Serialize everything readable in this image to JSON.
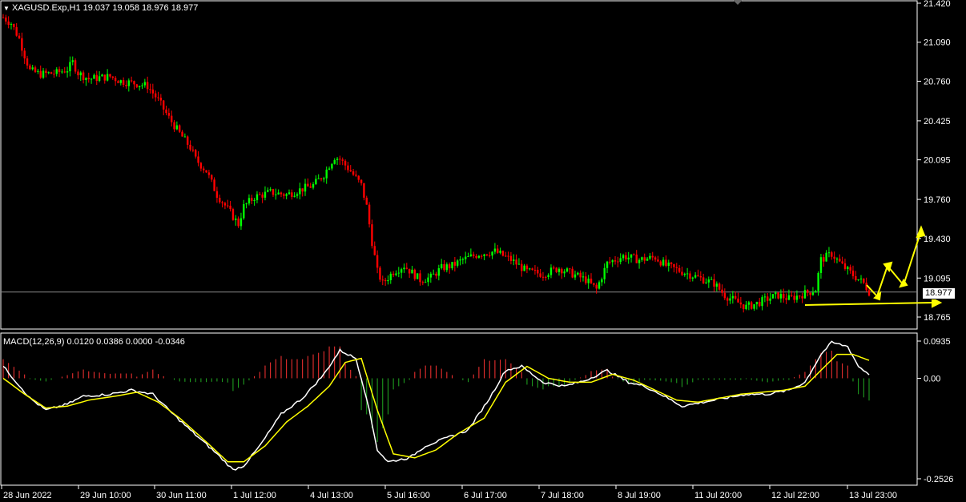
{
  "header": {
    "symbol_line": "XAGUSD.Exp,H1  19.037 19.058 18.976 18.977",
    "macd_line": "MACD(12,26,9) 0.0120 0.0386 0.0000 -0.0346"
  },
  "current_price": "18.977",
  "colors": {
    "background": "#000000",
    "bull": "#00ff00",
    "bear": "#ff0000",
    "macd_line": "#ffffff",
    "signal_line": "#ffff00",
    "hist_pos": "#ff3333",
    "hist_neg": "#22aa22",
    "annotation": "#ffff00"
  },
  "chart_data": [
    {
      "type": "candlestick",
      "symbol": "XAGUSD.Exp",
      "timeframe": "H1",
      "y_ticks": [
        "21.420",
        "21.090",
        "20.760",
        "20.425",
        "20.095",
        "19.760",
        "19.430",
        "19.095",
        "18.765"
      ],
      "ylim": [
        18.6,
        21.42
      ],
      "x_ticks": [
        "28 Jun 2022",
        "29 Jun 10:00",
        "30 Jun 11:00",
        "1 Jul 12:00",
        "4 Jul 13:00",
        "5 Jul 16:00",
        "6 Jul 17:00",
        "7 Jul 18:00",
        "8 Jul 19:00",
        "11 Jul 20:00",
        "12 Jul 22:00",
        "13 Jul 23:00"
      ],
      "close_path": [
        [
          0,
          21.3
        ],
        [
          3,
          21.25
        ],
        [
          6,
          21.12
        ],
        [
          8,
          20.98
        ],
        [
          10,
          20.85
        ],
        [
          14,
          20.82
        ],
        [
          20,
          20.83
        ],
        [
          24,
          20.86
        ],
        [
          26,
          20.92
        ],
        [
          28,
          20.83
        ],
        [
          32,
          20.78
        ],
        [
          40,
          20.8
        ],
        [
          44,
          20.76
        ],
        [
          50,
          20.74
        ],
        [
          54,
          20.72
        ],
        [
          58,
          20.6
        ],
        [
          62,
          20.45
        ],
        [
          66,
          20.32
        ],
        [
          70,
          20.2
        ],
        [
          72,
          20.1
        ],
        [
          76,
          20.0
        ],
        [
          80,
          19.8
        ],
        [
          84,
          19.68
        ],
        [
          88,
          19.55
        ],
        [
          90,
          19.7
        ],
        [
          94,
          19.78
        ],
        [
          100,
          19.82
        ],
        [
          106,
          19.8
        ],
        [
          112,
          19.85
        ],
        [
          116,
          19.88
        ],
        [
          120,
          19.97
        ],
        [
          122,
          20.05
        ],
        [
          124,
          20.12
        ],
        [
          126,
          20.1
        ],
        [
          130,
          20.0
        ],
        [
          134,
          19.88
        ],
        [
          136,
          19.7
        ],
        [
          138,
          19.4
        ],
        [
          140,
          19.15
        ],
        [
          142,
          19.05
        ],
        [
          146,
          19.15
        ],
        [
          150,
          19.2
        ],
        [
          156,
          19.08
        ],
        [
          160,
          19.1
        ],
        [
          164,
          19.18
        ],
        [
          168,
          19.2
        ],
        [
          172,
          19.25
        ],
        [
          178,
          19.3
        ],
        [
          184,
          19.32
        ],
        [
          190,
          19.25
        ],
        [
          196,
          19.15
        ],
        [
          202,
          19.13
        ],
        [
          208,
          19.18
        ],
        [
          214,
          19.12
        ],
        [
          218,
          19.08
        ],
        [
          222,
          19.0
        ],
        [
          226,
          19.22
        ],
        [
          232,
          19.28
        ],
        [
          238,
          19.25
        ],
        [
          244,
          19.27
        ],
        [
          248,
          19.2
        ],
        [
          254,
          19.15
        ],
        [
          260,
          19.1
        ],
        [
          266,
          19.05
        ],
        [
          270,
          18.95
        ],
        [
          274,
          18.9
        ],
        [
          278,
          18.85
        ],
        [
          282,
          18.88
        ],
        [
          286,
          18.92
        ],
        [
          290,
          18.95
        ],
        [
          294,
          18.92
        ],
        [
          298,
          18.95
        ],
        [
          302,
          18.98
        ],
        [
          304,
          19.0
        ],
        [
          306,
          19.25
        ],
        [
          310,
          19.3
        ],
        [
          314,
          19.2
        ],
        [
          318,
          19.12
        ],
        [
          322,
          19.05
        ],
        [
          324,
          18.98
        ]
      ],
      "current_price": 18.977,
      "annotations": [
        "yellow zigzag projection arrow",
        "yellow horizontal arrow at 18.86"
      ]
    },
    {
      "type": "line",
      "name": "MACD(12,26,9)",
      "y_ticks": [
        "0.0935",
        "0.00",
        "-0.2526"
      ],
      "ylim": [
        -0.2526,
        0.0935
      ],
      "series": [
        {
          "name": "MACD",
          "points": [
            [
              0,
              0.03
            ],
            [
              10,
              -0.05
            ],
            [
              16,
              -0.08
            ],
            [
              24,
              -0.065
            ],
            [
              30,
              -0.045
            ],
            [
              40,
              -0.04
            ],
            [
              48,
              -0.03
            ],
            [
              56,
              -0.04
            ],
            [
              62,
              -0.08
            ],
            [
              70,
              -0.13
            ],
            [
              80,
              -0.19
            ],
            [
              86,
              -0.23
            ],
            [
              90,
              -0.22
            ],
            [
              96,
              -0.17
            ],
            [
              104,
              -0.09
            ],
            [
              112,
              -0.05
            ],
            [
              120,
              0.01
            ],
            [
              126,
              0.07
            ],
            [
              132,
              0.05
            ],
            [
              136,
              -0.05
            ],
            [
              140,
              -0.18
            ],
            [
              144,
              -0.21
            ],
            [
              152,
              -0.2
            ],
            [
              158,
              -0.17
            ],
            [
              166,
              -0.15
            ],
            [
              174,
              -0.13
            ],
            [
              182,
              -0.05
            ],
            [
              188,
              0.02
            ],
            [
              194,
              0.03
            ],
            [
              202,
              -0.01
            ],
            [
              210,
              -0.02
            ],
            [
              218,
              -0.005
            ],
            [
              226,
              0.02
            ],
            [
              234,
              -0.01
            ],
            [
              240,
              -0.02
            ],
            [
              246,
              -0.04
            ],
            [
              254,
              -0.07
            ],
            [
              262,
              -0.06
            ],
            [
              270,
              -0.05
            ],
            [
              278,
              -0.04
            ],
            [
              286,
              -0.04
            ],
            [
              294,
              -0.03
            ],
            [
              300,
              -0.01
            ],
            [
              306,
              0.06
            ],
            [
              310,
              0.09
            ],
            [
              316,
              0.08
            ],
            [
              320,
              0.03
            ],
            [
              324,
              0.01
            ]
          ]
        },
        {
          "name": "Signal",
          "points": [
            [
              0,
              0.0
            ],
            [
              8,
              -0.04
            ],
            [
              16,
              -0.075
            ],
            [
              24,
              -0.07
            ],
            [
              32,
              -0.055
            ],
            [
              42,
              -0.045
            ],
            [
              50,
              -0.035
            ],
            [
              58,
              -0.06
            ],
            [
              66,
              -0.1
            ],
            [
              76,
              -0.16
            ],
            [
              84,
              -0.21
            ],
            [
              90,
              -0.21
            ],
            [
              98,
              -0.17
            ],
            [
              106,
              -0.11
            ],
            [
              114,
              -0.07
            ],
            [
              122,
              -0.02
            ],
            [
              128,
              0.04
            ],
            [
              134,
              0.05
            ],
            [
              140,
              -0.08
            ],
            [
              146,
              -0.19
            ],
            [
              154,
              -0.2
            ],
            [
              162,
              -0.18
            ],
            [
              170,
              -0.14
            ],
            [
              180,
              -0.1
            ],
            [
              188,
              -0.01
            ],
            [
              196,
              0.03
            ],
            [
              204,
              0.0
            ],
            [
              212,
              -0.01
            ],
            [
              220,
              -0.01
            ],
            [
              228,
              0.01
            ],
            [
              236,
              -0.005
            ],
            [
              244,
              -0.03
            ],
            [
              252,
              -0.055
            ],
            [
              260,
              -0.06
            ],
            [
              268,
              -0.05
            ],
            [
              276,
              -0.04
            ],
            [
              284,
              -0.035
            ],
            [
              292,
              -0.03
            ],
            [
              300,
              -0.02
            ],
            [
              306,
              0.02
            ],
            [
              312,
              0.06
            ],
            [
              318,
              0.06
            ],
            [
              324,
              0.045
            ]
          ]
        },
        {
          "name": "Histogram",
          "note": "alternating red (positive) / green (negative) vertical bars"
        }
      ]
    }
  ]
}
